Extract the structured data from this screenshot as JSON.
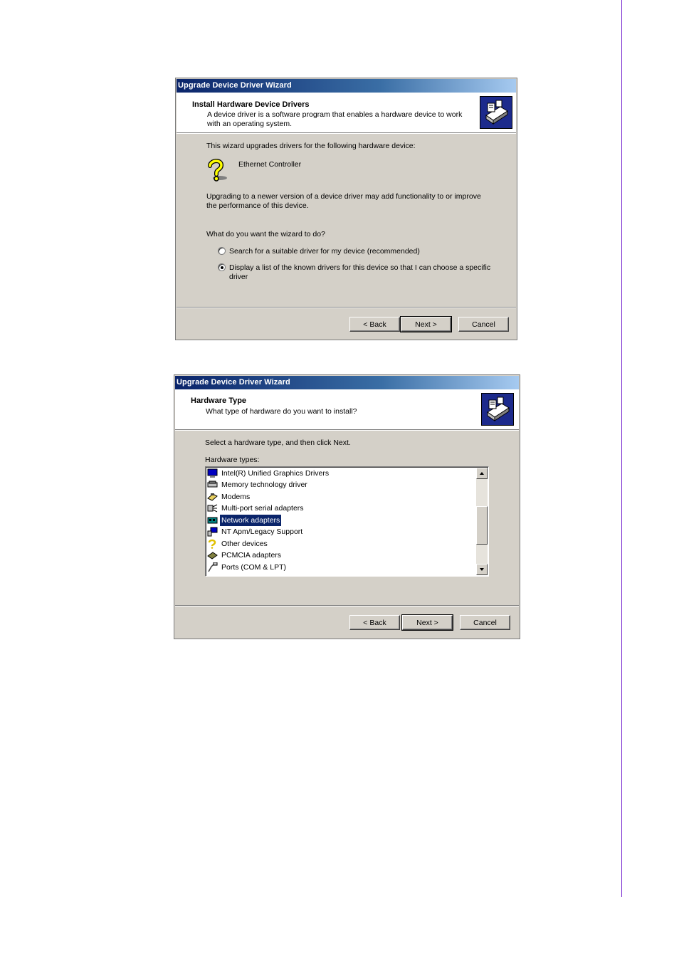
{
  "dialog1": {
    "title": "Upgrade Device Driver Wizard",
    "header_title": "Install Hardware Device Drivers",
    "header_subtitle": "A device driver is a software program that enables a hardware device to work with an operating system.",
    "intro": "This wizard upgrades drivers for the following hardware device:",
    "device_name": "Ethernet Controller",
    "upgrade_note": "Upgrading to a newer version of a device driver may add functionality to or improve the performance of this device.",
    "question": "What do you want the wizard to do?",
    "options": [
      {
        "label": "Search for a suitable driver for my device (recommended)",
        "selected": false
      },
      {
        "label": "Display a list of the known drivers for this device so that I can choose a specific driver",
        "selected": true
      }
    ],
    "buttons": {
      "back": "< Back",
      "next": "Next >",
      "cancel": "Cancel"
    }
  },
  "dialog2": {
    "title": "Upgrade Device Driver Wizard",
    "header_title": "Hardware Type",
    "header_subtitle": "What type of hardware do you want to install?",
    "instruction": "Select a hardware type, and then click Next.",
    "list_label": "Hardware types:",
    "hardware_types": [
      {
        "label": "Intel(R) Unified Graphics Drivers",
        "icon": "monitor-icon",
        "selected": false
      },
      {
        "label": "Memory technology driver",
        "icon": "memory-icon",
        "selected": false
      },
      {
        "label": "Modems",
        "icon": "modem-icon",
        "selected": false
      },
      {
        "label": "Multi-port serial adapters",
        "icon": "serial-adapter-icon",
        "selected": false
      },
      {
        "label": "Network adapters",
        "icon": "network-adapter-icon",
        "selected": true
      },
      {
        "label": "NT Apm/Legacy Support",
        "icon": "computer-icon",
        "selected": false
      },
      {
        "label": "Other devices",
        "icon": "question-mark-icon",
        "selected": false
      },
      {
        "label": "PCMCIA adapters",
        "icon": "pcmcia-icon",
        "selected": false
      },
      {
        "label": "Ports (COM & LPT)",
        "icon": "port-icon",
        "selected": false
      }
    ],
    "buttons": {
      "back": "< Back",
      "next": "Next >",
      "cancel": "Cancel"
    }
  },
  "colors": {
    "dialog_face": "#d4d0c8",
    "title_gradient_start": "#0a246a",
    "title_gradient_end": "#a6caf0",
    "selection": "#0a246a",
    "page_rule": "#7b2fd0"
  }
}
